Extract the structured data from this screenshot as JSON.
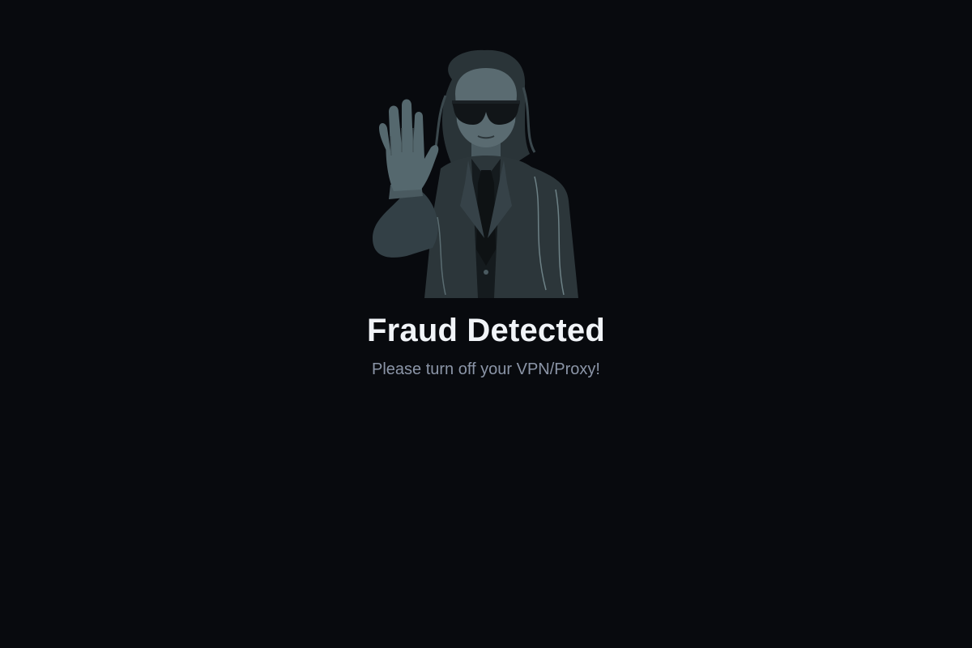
{
  "page": {
    "title": "Fraud Detected",
    "message": "Please turn off your VPN/Proxy!"
  },
  "illustration": {
    "icon": "agent-stop-hand-illustration",
    "description_colors": {
      "background": "#080a0e",
      "figure": "#3b4a50"
    }
  },
  "colors": {
    "background": "#080a0e",
    "title": "#f1f4f8",
    "subtitle": "#8b95a7"
  }
}
